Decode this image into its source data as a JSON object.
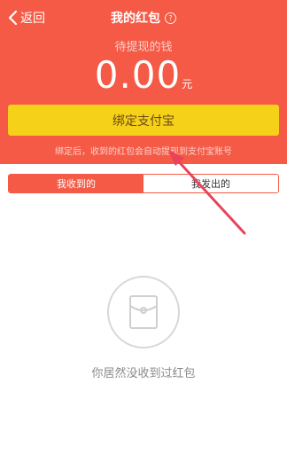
{
  "nav": {
    "back_label": "返回",
    "title": "我的红包",
    "help_symbol": "?"
  },
  "balance": {
    "caption": "待提现的钱",
    "amount": "0.00",
    "unit": "元"
  },
  "bind_button": {
    "label": "绑定支付宝"
  },
  "hint": {
    "text": "绑定后，收到的红包会自动提现到支付宝账号"
  },
  "tabs": [
    {
      "label": "我收到的",
      "active": true
    },
    {
      "label": "我发出的",
      "active": false
    }
  ],
  "empty_state": {
    "icon": "red-envelope-icon",
    "text": "你居然没收到过红包"
  },
  "colors": {
    "header": "#f45a45",
    "button": "#f6d119",
    "annotation_arrow": "#e8435a"
  }
}
